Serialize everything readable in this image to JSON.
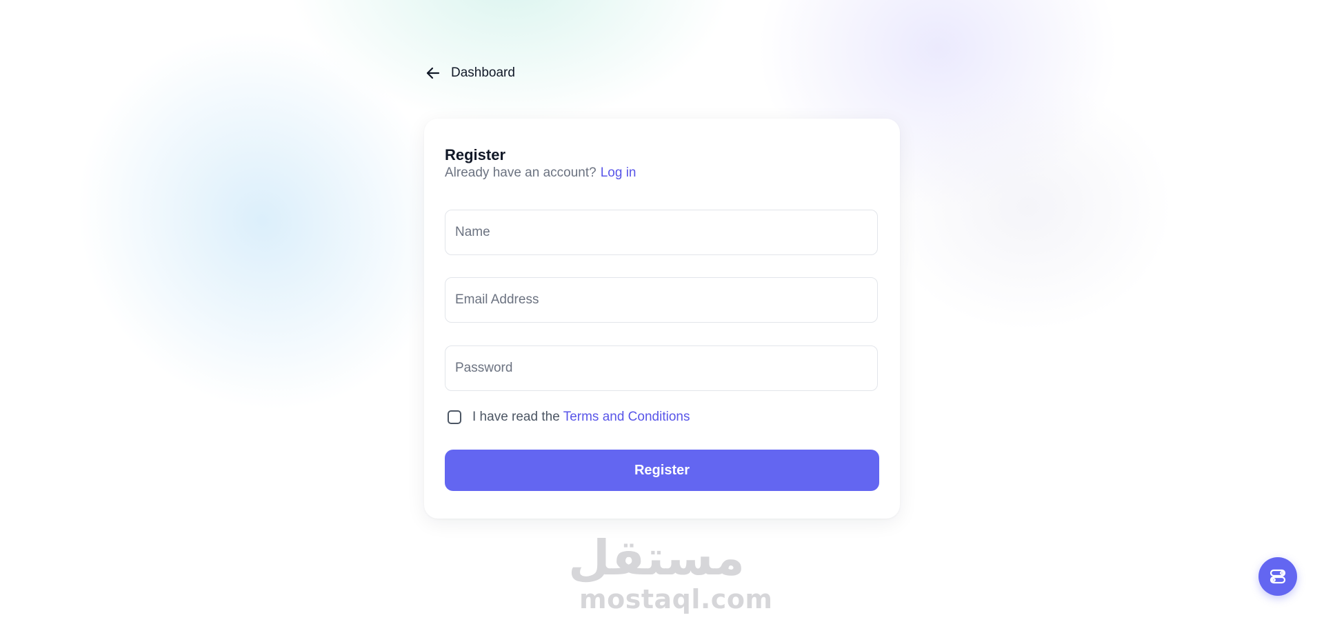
{
  "nav": {
    "back_icon": "arrow-left-icon",
    "back_label": "Dashboard"
  },
  "register_form": {
    "title": "Register",
    "subtitle": "Already have an account?",
    "login_link": "Log in",
    "name_placeholder": "Name",
    "email_placeholder": "Email Address",
    "password_placeholder": "Password",
    "terms_prefix": "I have read the",
    "terms_link": "Terms and Conditions",
    "terms_checked": false,
    "submit_label": "Register"
  },
  "watermark": {
    "mark": "مستقل",
    "domain": "mostaql.com"
  },
  "floating_button": {
    "icon": "toggle-settings-icon"
  },
  "colors": {
    "accent": "#6366f1",
    "link": "#5855e8",
    "background": "#ffffff",
    "card": "#ffffff"
  }
}
